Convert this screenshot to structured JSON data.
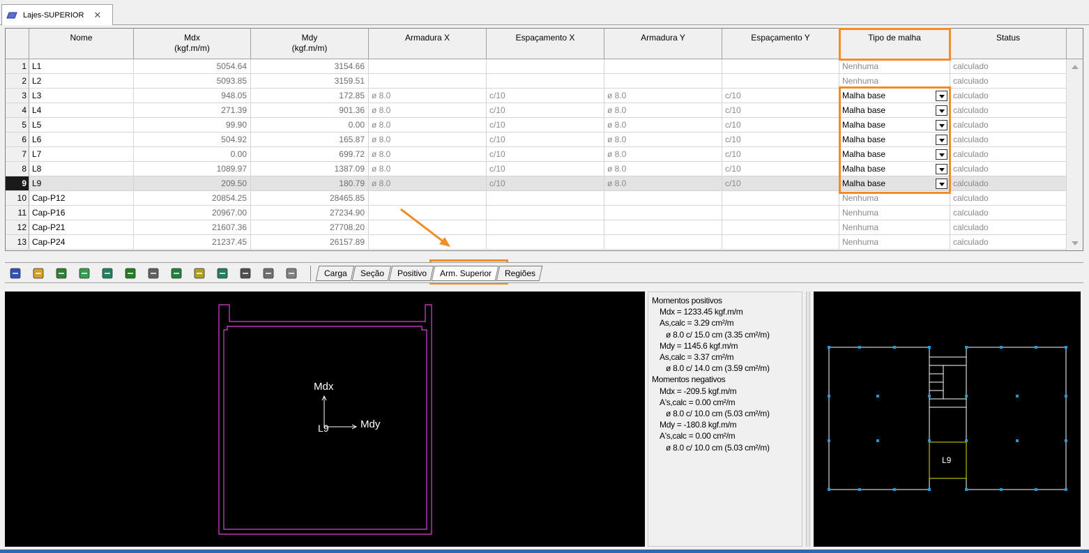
{
  "document_tab": {
    "label": "Lajes-SUPERIOR",
    "close": "✕"
  },
  "columns": [
    {
      "line1": "Nome",
      "line2": ""
    },
    {
      "line1": "Mdx",
      "line2": "(kgf.m/m)"
    },
    {
      "line1": "Mdy",
      "line2": "(kgf.m/m)"
    },
    {
      "line1": "Armadura X",
      "line2": ""
    },
    {
      "line1": "Espaçamento X",
      "line2": ""
    },
    {
      "line1": "Armadura Y",
      "line2": ""
    },
    {
      "line1": "Espaçamento Y",
      "line2": ""
    },
    {
      "line1": "Tipo de malha",
      "line2": ""
    },
    {
      "line1": "Status",
      "line2": ""
    }
  ],
  "rows": [
    {
      "n": "1",
      "nome": "L1",
      "mdx": "5054.64",
      "mdy": "3154.66",
      "armx": "",
      "espx": "",
      "army": "",
      "espy": "",
      "tipo": "Nenhuma",
      "dropdown": false,
      "status": "calculado"
    },
    {
      "n": "2",
      "nome": "L2",
      "mdx": "5093.85",
      "mdy": "3159.51",
      "armx": "",
      "espx": "",
      "army": "",
      "espy": "",
      "tipo": "Nenhuma",
      "dropdown": false,
      "status": "calculado"
    },
    {
      "n": "3",
      "nome": "L3",
      "mdx": "948.05",
      "mdy": "172.85",
      "armx": "ø 8.0",
      "espx": "c/10",
      "army": "ø 8.0",
      "espy": "c/10",
      "tipo": "Malha base",
      "dropdown": true,
      "status": "calculado"
    },
    {
      "n": "4",
      "nome": "L4",
      "mdx": "271.39",
      "mdy": "901.36",
      "armx": "ø 8.0",
      "espx": "c/10",
      "army": "ø 8.0",
      "espy": "c/10",
      "tipo": "Malha base",
      "dropdown": true,
      "status": "calculado"
    },
    {
      "n": "5",
      "nome": "L5",
      "mdx": "99.90",
      "mdy": "0.00",
      "armx": "ø 8.0",
      "espx": "c/10",
      "army": "ø 8.0",
      "espy": "c/10",
      "tipo": "Malha base",
      "dropdown": true,
      "status": "calculado"
    },
    {
      "n": "6",
      "nome": "L6",
      "mdx": "504.92",
      "mdy": "165.87",
      "armx": "ø 8.0",
      "espx": "c/10",
      "army": "ø 8.0",
      "espy": "c/10",
      "tipo": "Malha base",
      "dropdown": true,
      "status": "calculado"
    },
    {
      "n": "7",
      "nome": "L7",
      "mdx": "0.00",
      "mdy": "699.72",
      "armx": "ø 8.0",
      "espx": "c/10",
      "army": "ø 8.0",
      "espy": "c/10",
      "tipo": "Malha base",
      "dropdown": true,
      "status": "calculado"
    },
    {
      "n": "8",
      "nome": "L8",
      "mdx": "1089.97",
      "mdy": "1387.09",
      "armx": "ø 8.0",
      "espx": "c/10",
      "army": "ø 8.0",
      "espy": "c/10",
      "tipo": "Malha base",
      "dropdown": true,
      "status": "calculado"
    },
    {
      "n": "9",
      "nome": "L9",
      "mdx": "209.50",
      "mdy": "180.79",
      "armx": "ø 8.0",
      "espx": "c/10",
      "army": "ø 8.0",
      "espy": "c/10",
      "tipo": "Malha base",
      "dropdown": true,
      "status": "calculado",
      "selected": true
    },
    {
      "n": "10",
      "nome": "Cap-P12",
      "mdx": "20854.25",
      "mdy": "28465.85",
      "armx": "",
      "espx": "",
      "army": "",
      "espy": "",
      "tipo": "Nenhuma",
      "dropdown": false,
      "status": "calculado"
    },
    {
      "n": "11",
      "nome": "Cap-P16",
      "mdx": "20967.00",
      "mdy": "27234.90",
      "armx": "",
      "espx": "",
      "army": "",
      "espy": "",
      "tipo": "Nenhuma",
      "dropdown": false,
      "status": "calculado"
    },
    {
      "n": "12",
      "nome": "Cap-P21",
      "mdx": "21607.36",
      "mdy": "27708.20",
      "armx": "",
      "espx": "",
      "army": "",
      "espy": "",
      "tipo": "Nenhuma",
      "dropdown": false,
      "status": "calculado"
    },
    {
      "n": "13",
      "nome": "Cap-P24",
      "mdx": "21237.45",
      "mdy": "26157.89",
      "armx": "",
      "espx": "",
      "army": "",
      "espy": "",
      "tipo": "Nenhuma",
      "dropdown": false,
      "status": "calculado"
    }
  ],
  "toolbar_icons": [
    "table-icon",
    "lock-icon",
    "calculator-icon",
    "report-icon",
    "grid-edit-icon",
    "axis-split-icon",
    "load-icon",
    "moment-icon",
    "mesh-icon",
    "dimension-icon",
    "section-icon",
    "rebar-icon",
    "document-icon"
  ],
  "tabs": [
    {
      "label": "Carga",
      "active": false
    },
    {
      "label": "Seção",
      "active": false
    },
    {
      "label": "Positivo",
      "active": false
    },
    {
      "label": "Arm. Superior",
      "active": true
    },
    {
      "label": "Regiões",
      "active": false
    }
  ],
  "drawing": {
    "label_mdx": "Mdx",
    "label_mdy": "Mdy",
    "slab_label": "L9"
  },
  "info": [
    {
      "text": "Momentos positivos",
      "level": 0
    },
    {
      "text": "Mdx = 1233.45 kgf.m/m",
      "level": 1
    },
    {
      "text": "As,calc = 3.29 cm²/m",
      "level": 1
    },
    {
      "text": "ø 8.0 c/ 15.0 cm (3.35 cm²/m)",
      "level": 2
    },
    {
      "text": "Mdy = 1145.6 kgf.m/m",
      "level": 1
    },
    {
      "text": "As,calc = 3.37 cm²/m",
      "level": 1
    },
    {
      "text": "ø 8.0 c/ 14.0 cm (3.59 cm²/m)",
      "level": 2
    },
    {
      "text": "Momentos negativos",
      "level": 0
    },
    {
      "text": "Mdx = -209.5 kgf.m/m",
      "level": 1
    },
    {
      "text": "A's,calc = 0.00 cm²/m",
      "level": 1
    },
    {
      "text": "ø 8.0 c/ 10.0 cm (5.03 cm²/m)",
      "level": 2
    },
    {
      "text": "Mdy = -180.8 kgf.m/m",
      "level": 1
    },
    {
      "text": "A's,calc = 0.00 cm²/m",
      "level": 1
    },
    {
      "text": "ø 8.0 c/ 10.0 cm (5.03 cm²/m)",
      "level": 2
    }
  ],
  "mini_plan": {
    "slab_label": "L9"
  },
  "colors": {
    "highlight": "#f28c28",
    "slab_outline": "#e040e0",
    "selected_slab": "#e0e000",
    "plan_lines": "#ffffff",
    "plan_nodes": "#1e9bd7"
  }
}
